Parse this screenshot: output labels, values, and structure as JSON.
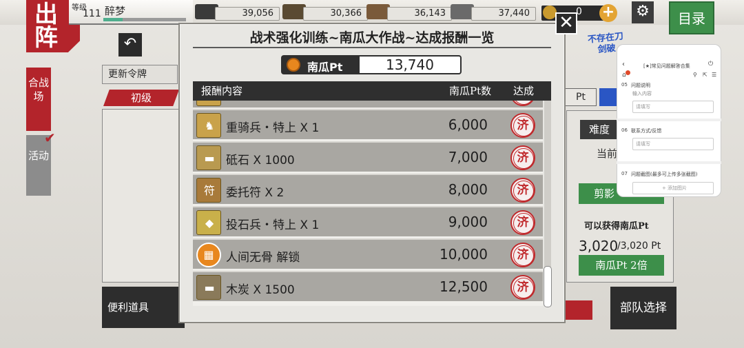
{
  "header": {
    "sortie_label": "出阵",
    "level_label": "等级",
    "level_value": "111",
    "player_name": "醉梦",
    "resources": [
      {
        "icon": "charcoal-icon",
        "value": "39,056",
        "color": "#3a3a3a"
      },
      {
        "icon": "steel-icon",
        "value": "30,366",
        "color": "#5a4a32"
      },
      {
        "icon": "cooling-material-icon",
        "value": "36,143",
        "color": "#7a5a3a"
      },
      {
        "icon": "whetstone-icon",
        "value": "37,440",
        "color": "#6a6a6a"
      }
    ],
    "coin_value": "0",
    "plus_label": "+",
    "settings_icon": "gear-icon",
    "menu_label": "目录"
  },
  "left": {
    "back_icon": "back-arrow-icon",
    "update_token_label": "更新令牌",
    "tab_beginner": "初级",
    "side_gassenba": "合战场",
    "side_katsudo": "活动",
    "convenient_items": "便利道具"
  },
  "right": {
    "badge_text": "不存在刀剑破",
    "pt_label": "Pt",
    "difficulty_label": "难度",
    "current_label": "当前",
    "scene_button": "剪影",
    "can_get_label": "可以获得南瓜Pt",
    "pt_current": "3,020",
    "pt_max": "/3,020 Pt",
    "double_button": "南瓜Pt 2倍",
    "squad_select": "部队选择"
  },
  "modal": {
    "title": "战术强化训练~南瓜大作战~达成报酬一览",
    "close_label": "✕",
    "pt_label": "南瓜Pt",
    "pt_value": "13,740",
    "columns": {
      "content": "报酬内容",
      "pt": "南瓜Pt数",
      "achieved": "达成"
    },
    "rows": [
      {
        "name": "重骑兵・特上 X 1",
        "pt": "6,000",
        "status": "济",
        "icon": "heavy-cavalry-icon",
        "glyph": "♞"
      },
      {
        "name": "砥石 X 1000",
        "pt": "7,000",
        "status": "济",
        "icon": "whetstone-icon",
        "glyph": "▬"
      },
      {
        "name": "委托符 X 2",
        "pt": "8,000",
        "status": "济",
        "icon": "request-charm-icon",
        "glyph": "符"
      },
      {
        "name": "投石兵・特上 X 1",
        "pt": "9,000",
        "status": "济",
        "icon": "stone-thrower-icon",
        "glyph": "◆"
      },
      {
        "name": "人间无骨 解锁",
        "pt": "10,000",
        "status": "济",
        "icon": "grid-unlock-icon",
        "glyph": "▦"
      },
      {
        "name": "木炭 X 1500",
        "pt": "12,500",
        "status": "济",
        "icon": "charcoal-icon",
        "glyph": "▬"
      }
    ]
  },
  "mini_browser": {
    "back_icon": "chevron-left-icon",
    "title": "[★]常见问题解答合集",
    "items": [
      {
        "num": "05",
        "label": "问题说明",
        "sub": "输入内容",
        "placeholder": "请填写"
      },
      {
        "num": "06",
        "label": "联系方式/反馈",
        "sub": "",
        "placeholder": "请填写"
      },
      {
        "num": "07",
        "label": "问题截图(最多可上传多张截图)",
        "sub": "",
        "placeholder": "+ 添加图片"
      }
    ]
  }
}
